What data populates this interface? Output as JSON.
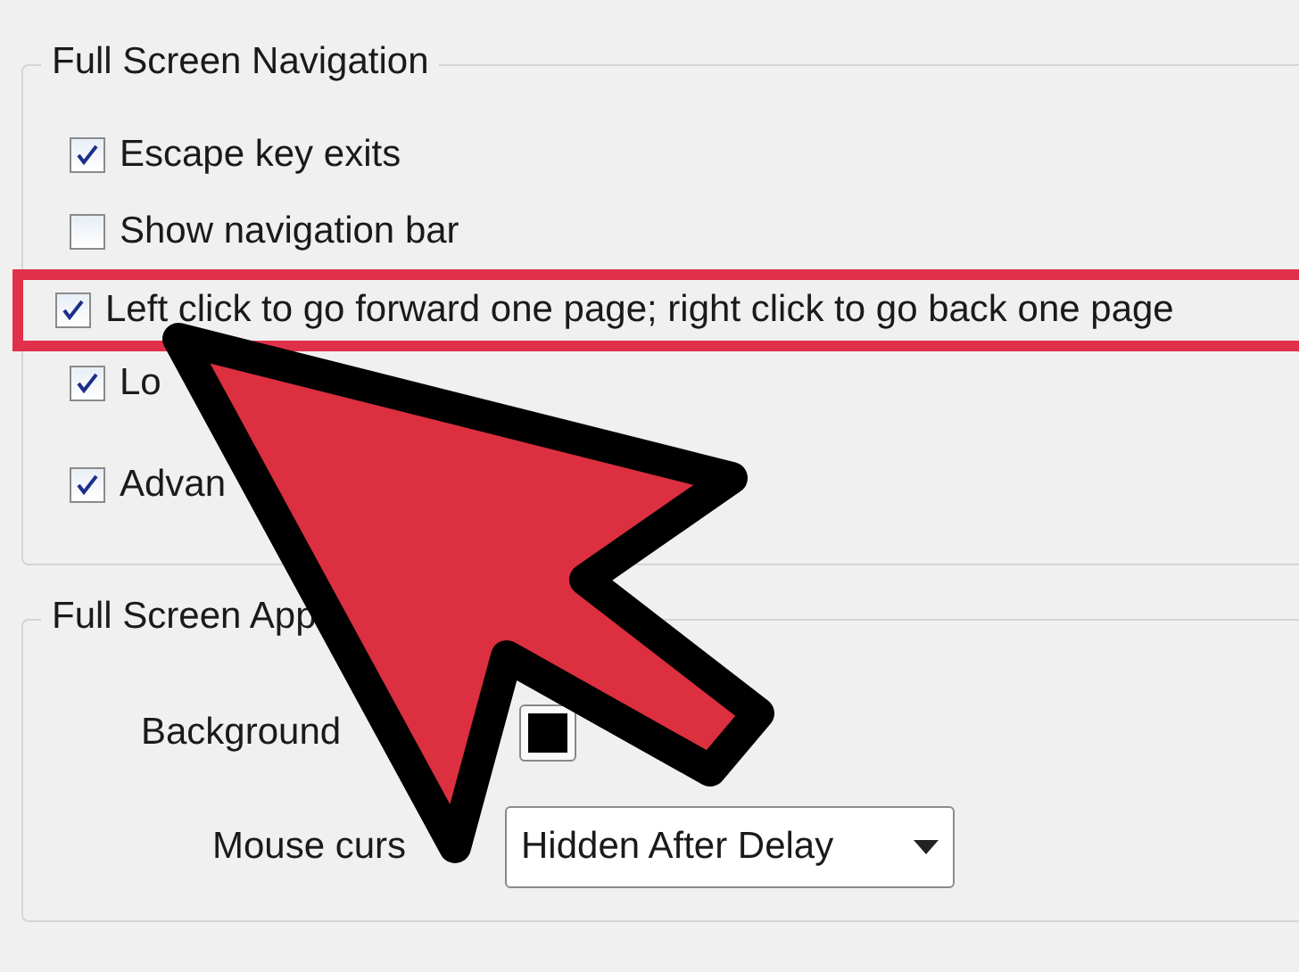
{
  "navigation_group": {
    "title": "Full Screen Navigation",
    "options": [
      {
        "label": "Escape key exits",
        "checked": true,
        "highlighted": false
      },
      {
        "label": "Show navigation bar",
        "checked": false,
        "highlighted": false
      },
      {
        "label": "Left click to go forward one page; right click to go back one page",
        "checked": true,
        "highlighted": true
      },
      {
        "label": "Lo",
        "checked": true,
        "highlighted": false
      },
      {
        "label": "Advan",
        "checked": true,
        "highlighted": false
      }
    ]
  },
  "appearance_group": {
    "title": "Full Screen App",
    "background_label": "Background",
    "mouse_cursor_label": "Mouse curs",
    "mouse_cursor_value": "Hidden After Delay"
  }
}
